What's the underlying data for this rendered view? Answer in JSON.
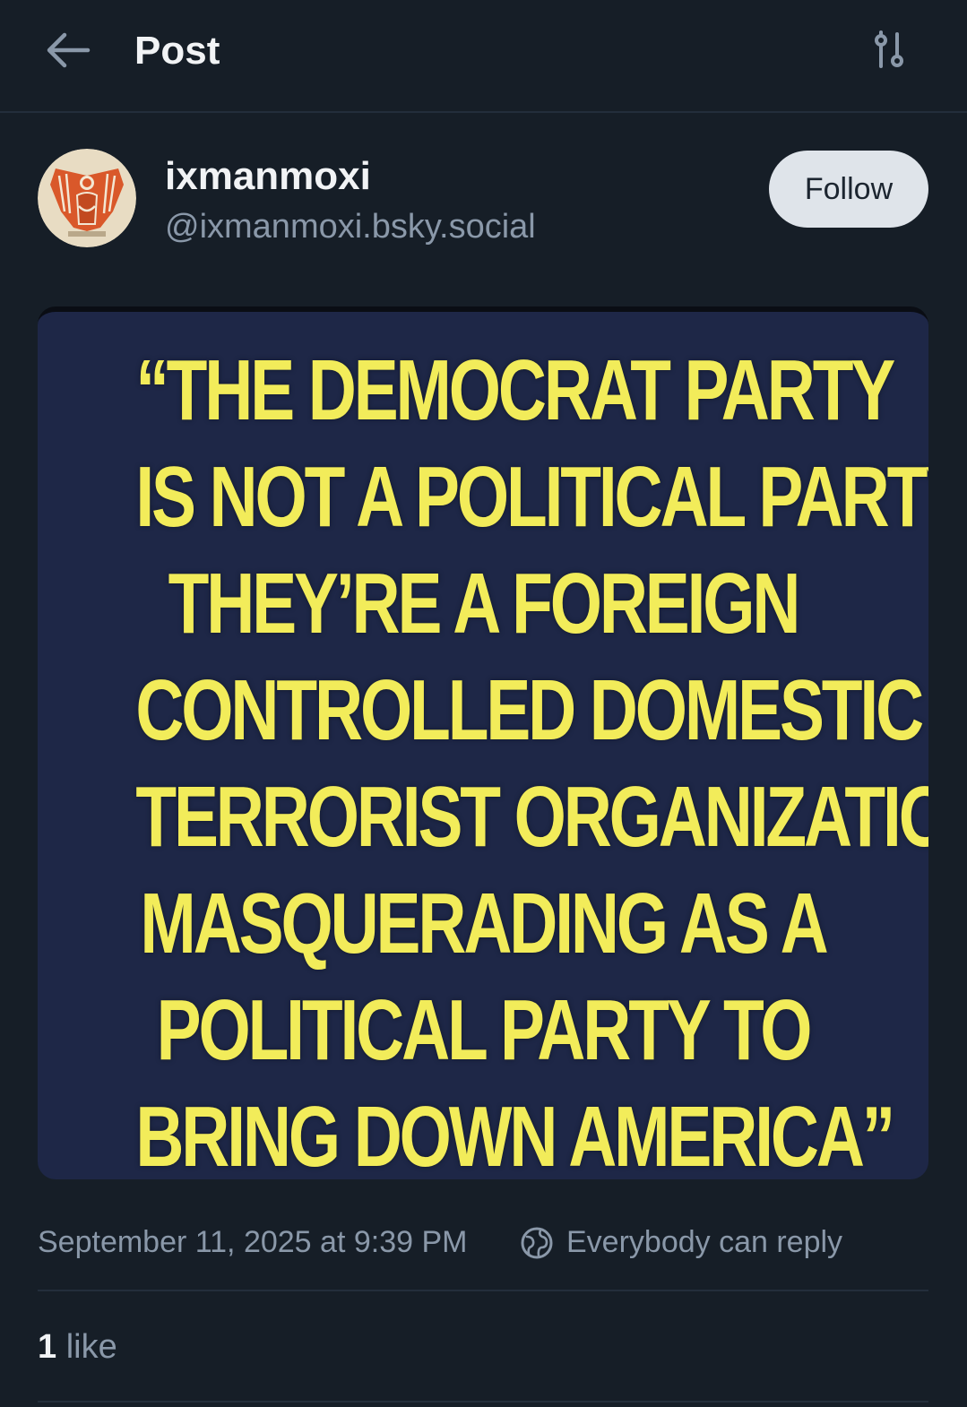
{
  "header": {
    "title": "Post",
    "back_icon": "arrow-left-icon",
    "filter_icon": "sliders-icon"
  },
  "author": {
    "display_name": "ixmanmoxi",
    "handle": "@ixmanmoxi.bsky.social",
    "follow_label": "Follow",
    "avatar_icon": "winged-figure-avatar"
  },
  "image": {
    "lines": [
      "“THE DEMOCRAT PARTY",
      "IS NOT A POLITICAL PARTY,",
      "THEY’RE A FOREIGN",
      "CONTROLLED DOMESTIC",
      "TERRORIST ORGANIZATION",
      "MASQUERADING AS A",
      "POLITICAL PARTY TO",
      "BRING DOWN AMERICA”"
    ],
    "text_color": "#f2ec5a",
    "background_color": "#1e2747"
  },
  "meta": {
    "timestamp": "September 11, 2025 at 9:39 PM",
    "reply_setting": "Everybody can reply",
    "reply_icon": "globe-icon"
  },
  "stats": {
    "likes_count": "1",
    "likes_label": " like"
  },
  "colors": {
    "background": "#161e27",
    "border": "#232e3b",
    "primary_text": "#f1f3f5",
    "secondary_text": "#8a98a9",
    "follow_button_bg": "#dfe4ea"
  }
}
